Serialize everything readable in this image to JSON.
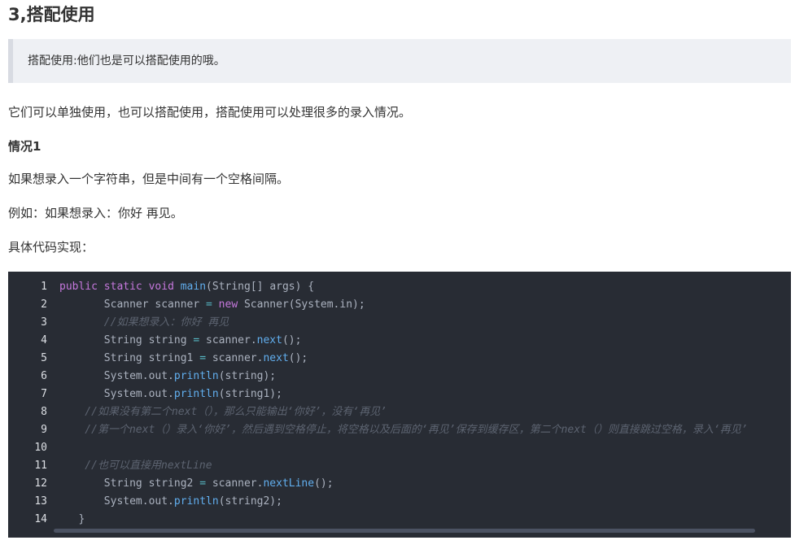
{
  "heading": "3,搭配使用",
  "blockquote": "搭配使用:他们也是可以搭配使用的哦。",
  "paragraphs": {
    "p1": "它们可以单独使用，也可以搭配使用，搭配使用可以处理很多的录入情况。",
    "case_title": "情况1",
    "p2": "如果想录入一个字符串，但是中间有一个空格间隔。",
    "p3": "例如：如果想录入：你好 再见。",
    "p4": "具体代码实现："
  },
  "code": {
    "line_numbers": [
      "1",
      "2",
      "3",
      "4",
      "5",
      "6",
      "7",
      "8",
      "9",
      "10",
      "11",
      "12",
      "13",
      "14"
    ],
    "lines": [
      [
        {
          "t": "public",
          "c": "kw"
        },
        {
          "t": " ",
          "c": "plain"
        },
        {
          "t": "static",
          "c": "kw"
        },
        {
          "t": " ",
          "c": "plain"
        },
        {
          "t": "void",
          "c": "kw"
        },
        {
          "t": " ",
          "c": "plain"
        },
        {
          "t": "main",
          "c": "fn"
        },
        {
          "t": "(String[] args) {",
          "c": "plain"
        }
      ],
      [
        {
          "t": "       Scanner scanner ",
          "c": "plain"
        },
        {
          "t": "=",
          "c": "op"
        },
        {
          "t": " ",
          "c": "plain"
        },
        {
          "t": "new",
          "c": "kw"
        },
        {
          "t": " Scanner(System.in);",
          "c": "plain"
        }
      ],
      [
        {
          "t": "       //如果想录入：你好 再见",
          "c": "cm"
        }
      ],
      [
        {
          "t": "       String string ",
          "c": "plain"
        },
        {
          "t": "=",
          "c": "op"
        },
        {
          "t": " scanner.",
          "c": "plain"
        },
        {
          "t": "next",
          "c": "fn"
        },
        {
          "t": "();",
          "c": "plain"
        }
      ],
      [
        {
          "t": "       String string1 ",
          "c": "plain"
        },
        {
          "t": "=",
          "c": "op"
        },
        {
          "t": " scanner.",
          "c": "plain"
        },
        {
          "t": "next",
          "c": "fn"
        },
        {
          "t": "();",
          "c": "plain"
        }
      ],
      [
        {
          "t": "       System.out.",
          "c": "plain"
        },
        {
          "t": "println",
          "c": "fn"
        },
        {
          "t": "(string);",
          "c": "plain"
        }
      ],
      [
        {
          "t": "       System.out.",
          "c": "plain"
        },
        {
          "t": "println",
          "c": "fn"
        },
        {
          "t": "(string1);",
          "c": "plain"
        }
      ],
      [
        {
          "t": "    //如果没有第二个next（），那么只能输出‘你好’，没有‘再见’",
          "c": "cm"
        }
      ],
      [
        {
          "t": "    //第一个next（）录入‘你好’，然后遇到空格停止，将空格以及后面的‘再见’保存到缓存区，第二个next（）则直接跳过空格，录入‘再见’",
          "c": "cm"
        }
      ],
      [
        {
          "t": "",
          "c": "plain"
        }
      ],
      [
        {
          "t": "    //也可以直接用nextLine",
          "c": "cm"
        }
      ],
      [
        {
          "t": "       String string2 ",
          "c": "plain"
        },
        {
          "t": "=",
          "c": "op"
        },
        {
          "t": " scanner.",
          "c": "plain"
        },
        {
          "t": "nextLine",
          "c": "fn"
        },
        {
          "t": "();",
          "c": "plain"
        }
      ],
      [
        {
          "t": "       System.out.",
          "c": "plain"
        },
        {
          "t": "println",
          "c": "fn"
        },
        {
          "t": "(string2);",
          "c": "plain"
        }
      ],
      [
        {
          "t": "   }",
          "c": "plain"
        }
      ]
    ]
  }
}
